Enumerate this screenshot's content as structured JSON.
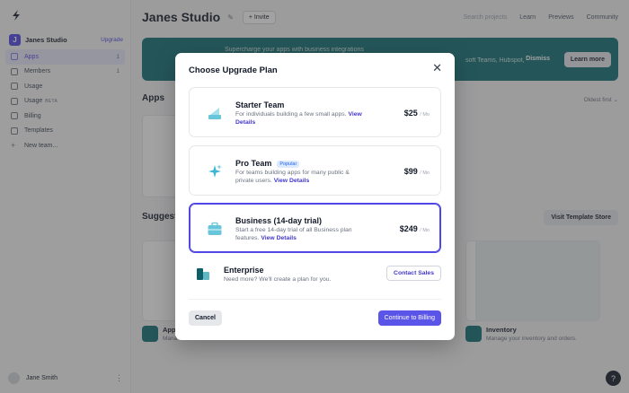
{
  "sidebar": {
    "workspace_initial": "J",
    "workspace_name": "Janes Studio",
    "upgrade_label": "Upgrade",
    "items": [
      {
        "label": "Apps",
        "count": "1"
      },
      {
        "label": "Members",
        "count": "1"
      },
      {
        "label": "Usage",
        "count": ""
      },
      {
        "label": "Usage",
        "badge": "BETA",
        "count": ""
      },
      {
        "label": "Billing",
        "count": ""
      },
      {
        "label": "Templates",
        "count": ""
      },
      {
        "label": "New team...",
        "count": ""
      }
    ],
    "user_name": "Jane Smith"
  },
  "header": {
    "title": "Janes Studio",
    "invite_label": "+ Invite",
    "search_placeholder": "Search projects",
    "learn_label": "Learn",
    "previews_label": "Previews",
    "community_label": "Community"
  },
  "banner": {
    "text": "Supercharge your apps with business integrations",
    "text2": "soft Teams, Hubspot,",
    "dismiss_label": "Dismiss",
    "learn_more_label": "Learn more"
  },
  "main": {
    "apps_heading": "Apps",
    "sort_label": "Oldest first ⌄",
    "suggested_heading": "Suggest",
    "template_store_label": "Visit Template Store",
    "app_title": "App",
    "app_desc": "Mana",
    "inventory_title": "Inventory",
    "inventory_desc": "Manage your inventory and orders."
  },
  "modal": {
    "title": "Choose Upgrade Plan",
    "plans": [
      {
        "name": "Starter Team",
        "desc": "For individuals building a few small apps.",
        "link": "View Details",
        "price": "$25",
        "per": "/ Mo",
        "badge": ""
      },
      {
        "name": "Pro Team",
        "desc": "For teams building apps for many public & private users.",
        "link": "View Details",
        "price": "$99",
        "per": "/ Mo",
        "badge": "Popular"
      },
      {
        "name": "Business (14-day trial)",
        "desc": "Start a free 14-day trial of all Business plan features.",
        "link": "View Details",
        "price": "$249",
        "per": "/ Mo",
        "badge": ""
      }
    ],
    "enterprise": {
      "name": "Enterprise",
      "desc": "Need more? We'll create a plan for you.",
      "contact_label": "Contact Sales"
    },
    "cancel_label": "Cancel",
    "continue_label": "Continue to Billing",
    "selected_plan_index": 2
  },
  "colors": {
    "accent": "#4f46e5",
    "teal": "#0e6e73"
  }
}
